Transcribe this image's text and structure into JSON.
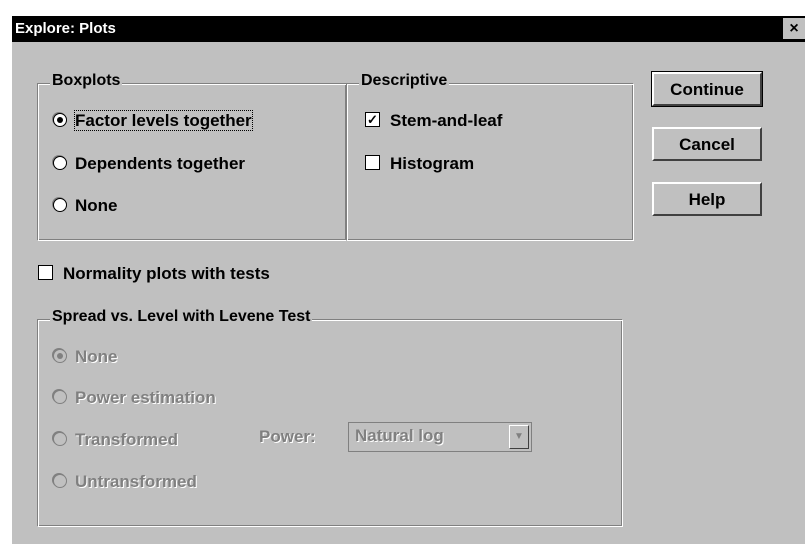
{
  "window": {
    "title": "Explore: Plots",
    "close_label": "×"
  },
  "boxplots": {
    "legend": "Boxplots",
    "options": [
      {
        "label": "Factor levels together",
        "checked": true
      },
      {
        "label": "Dependents together",
        "checked": false
      },
      {
        "label": "None",
        "checked": false
      }
    ]
  },
  "descriptive": {
    "legend": "Descriptive",
    "items": [
      {
        "label": "Stem-and-leaf",
        "checked": true,
        "mark": "✓"
      },
      {
        "label": "Histogram",
        "checked": false,
        "mark": ""
      }
    ]
  },
  "normality": {
    "label": "Normality plots with tests",
    "checked": false,
    "mark": ""
  },
  "spread": {
    "legend": "Spread vs. Level with Levene Test",
    "options": [
      {
        "label": "None",
        "checked": true
      },
      {
        "label": "Power estimation",
        "checked": false
      },
      {
        "label": "Transformed",
        "checked": false
      },
      {
        "label": "Untransformed",
        "checked": false
      }
    ],
    "power_label": "Power:",
    "power_value": "Natural log"
  },
  "buttons": {
    "continue": "Continue",
    "cancel": "Cancel",
    "help": "Help"
  }
}
